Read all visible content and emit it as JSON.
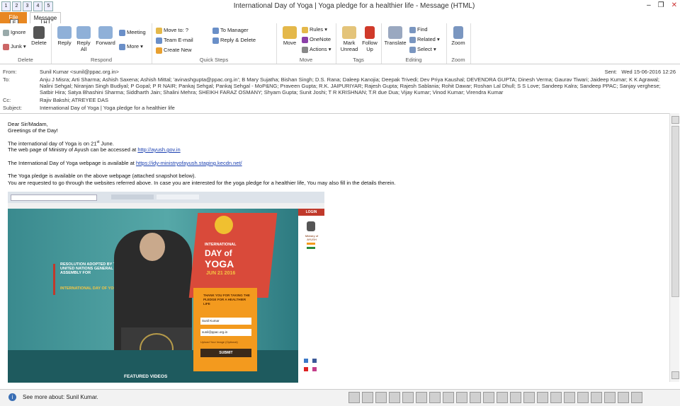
{
  "window": {
    "title": "International Day of Yoga | Yoga pledge for a healthier life - Message (HTML)",
    "qat_keys": [
      "1",
      "2",
      "3",
      "4",
      "5"
    ],
    "controls": [
      "–",
      "❐",
      "✕"
    ]
  },
  "tabs": {
    "file": "File",
    "file_key": "F",
    "message": "Message",
    "message_key": "H"
  },
  "ribbon": {
    "groups": {
      "delete": "Delete",
      "respond": "Respond",
      "quick_steps": "Quick Steps",
      "move": "Move",
      "tags": "Tags",
      "editing": "Editing",
      "zoom": "Zoom"
    },
    "ignore": "Ignore",
    "junk": "Junk",
    "delete": "Delete",
    "reply": "Reply",
    "reply_all": "Reply All",
    "forward": "Forward",
    "meeting": "Meeting",
    "more": "More",
    "move_to": "Move to: ?",
    "team_email": "Team E-mail",
    "create_new": "Create New",
    "to_manager": "To Manager",
    "reply_delete": "Reply & Delete",
    "move": "Move",
    "rules": "Rules",
    "onenote": "OneNote",
    "actions": "Actions",
    "mark_unread": "Mark Unread",
    "follow_up": "Follow Up",
    "translate": "Translate",
    "find": "Find",
    "related": "Related",
    "select": "Select",
    "zoom": "Zoom"
  },
  "header": {
    "from_label": "From:",
    "from": "Sunil Kumar <sunil@ppac.org.in>",
    "sent_label": "Sent:",
    "sent": "Wed 15-06-2016 12:26",
    "to_label": "To:",
    "to": "Anju J Misra; Arti Sharma; Ashish Saxena; Ashish Mittal; 'avinashgupta@ppac.org.in'; B Mary Sujatha; Bishan Singh; D.S. Rana; Daleep Kanojia; Deepak Trivedi; Dev Priya Kaushal; DEVENDRA GUPTA; Dinesh Verma; Gaurav Tiwari; Jaideep Kumar; K K Agrawal; Nalini Sehgal; Niranjan Singh Budiyal; P Gopal; P R NAIR; Pankaj Sehgal; Pankaj Sehgal - MoP&NG; Praveen Gupta; R.K. JAIPURIYAR; Rajesh Gupta; Rajesh Sablania; Rohit Dawar; Roshan Lal Dhull; S S Love; Sandeep Kalra; Sandeep PPAC; Sanjay verghese; Satbir Hira; Satya Bhashini Sharma; Siddharth Jain; Shalini Mehra; SHEIKH FARAZ OSMANY; Shyam Gupta; Sunit Joshi; T R KRISHNAN; T.R due Dua; Vijay Kumar; Vinod Kumar; Virendra Kumar",
    "cc_label": "Cc:",
    "cc": "Rajiv Bakshi; ATREYEE DAS",
    "subject_label": "Subject:",
    "subject": "International Day of Yoga | Yoga pledge for a healthier life"
  },
  "body": {
    "greeting": "Dear Sir/Madam,",
    "greeting2": "Greetings of the Day!",
    "line1_a": "The international day of Yoga is on 21",
    "line1_sup": "st",
    "line1_b": " June.",
    "line2_a": "The web page of Ministry of Ayush can be accessed at ",
    "line2_link": "http://ayush.gov.in",
    "line3_a": "The International Day of Yoga webpage is available at ",
    "line3_link": "https://idy-ministryofayush.staging.kecdn.net/",
    "line4": "The Yoga pledge is available on the above webpage (attached snapshot below).",
    "line5": "You are requested to go through the websites referred above. In case you are interested for the yoga pledge for a healthier life, You may also fill in the details therein."
  },
  "snapshot": {
    "resolution": "RESOLUTION ADOPTED BY THE UNITED NATIONS GENERAL ASSEMBLY FOR",
    "resolution2": "INTERNATIONAL DAY OF YOGA",
    "intl": "INTERNATIONAL",
    "day_of": "DAY of",
    "yoga": "YOGA",
    "date": "JUN 21 2016",
    "thank_you": "THANK YOU FOR TAKING THE PLEDGE FOR A HEALTHIER LIFE",
    "name_value": "Sunil Kumar",
    "email_value": "sunil@ppac.org.in",
    "upload": "Upload Your Image (Optional)",
    "submit": "SUBMIT",
    "login": "LOGIN",
    "ministry": "Ministry of AYUSH",
    "featured": "FEATURED VIDEOS"
  },
  "status": {
    "info": "See more about: Sunil Kumar."
  }
}
